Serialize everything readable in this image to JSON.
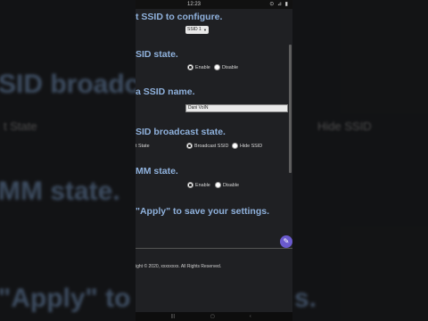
{
  "background": {
    "ssid_broadcast": "SID broadcas",
    "state_left": "t State",
    "hide_ssid": "Hide SSID",
    "mm_state": "MM state.",
    "apply_text": "\"Apply\" to sav",
    "apply_tail": "s."
  },
  "statusbar": {
    "time": "12:23",
    "icons": "⊙ ⊿ ▮"
  },
  "config": {
    "configure_heading": "t SSID to configure.",
    "ssid_select": "SSID 1",
    "ssid_state_heading": "SID state.",
    "enable": "Enable",
    "disable": "Disable",
    "ssid_name_heading": "a SSID name.",
    "ssid_name_value": "Dani VoIN",
    "broadcast_heading": "SID broadcast state.",
    "state_label": "t State",
    "broadcast_ssid": "Broadcast SSID",
    "hide_ssid": "Hide SSID",
    "wmm_heading": "MM state.",
    "wmm_enable": "Enable",
    "wmm_disable": "Disable",
    "apply_heading": "\"Apply\" to save your settings."
  },
  "footer": {
    "copyright": "ight © 2020, xxxxxxxx. All Rights Reserved."
  },
  "icons": {
    "fab": "pencil-icon",
    "nav": [
      "recents-icon",
      "home-icon",
      "back-icon"
    ]
  },
  "colors": {
    "heading": "#8fb1dc",
    "accent": "#6a5acd",
    "panel": "#1f2023"
  }
}
